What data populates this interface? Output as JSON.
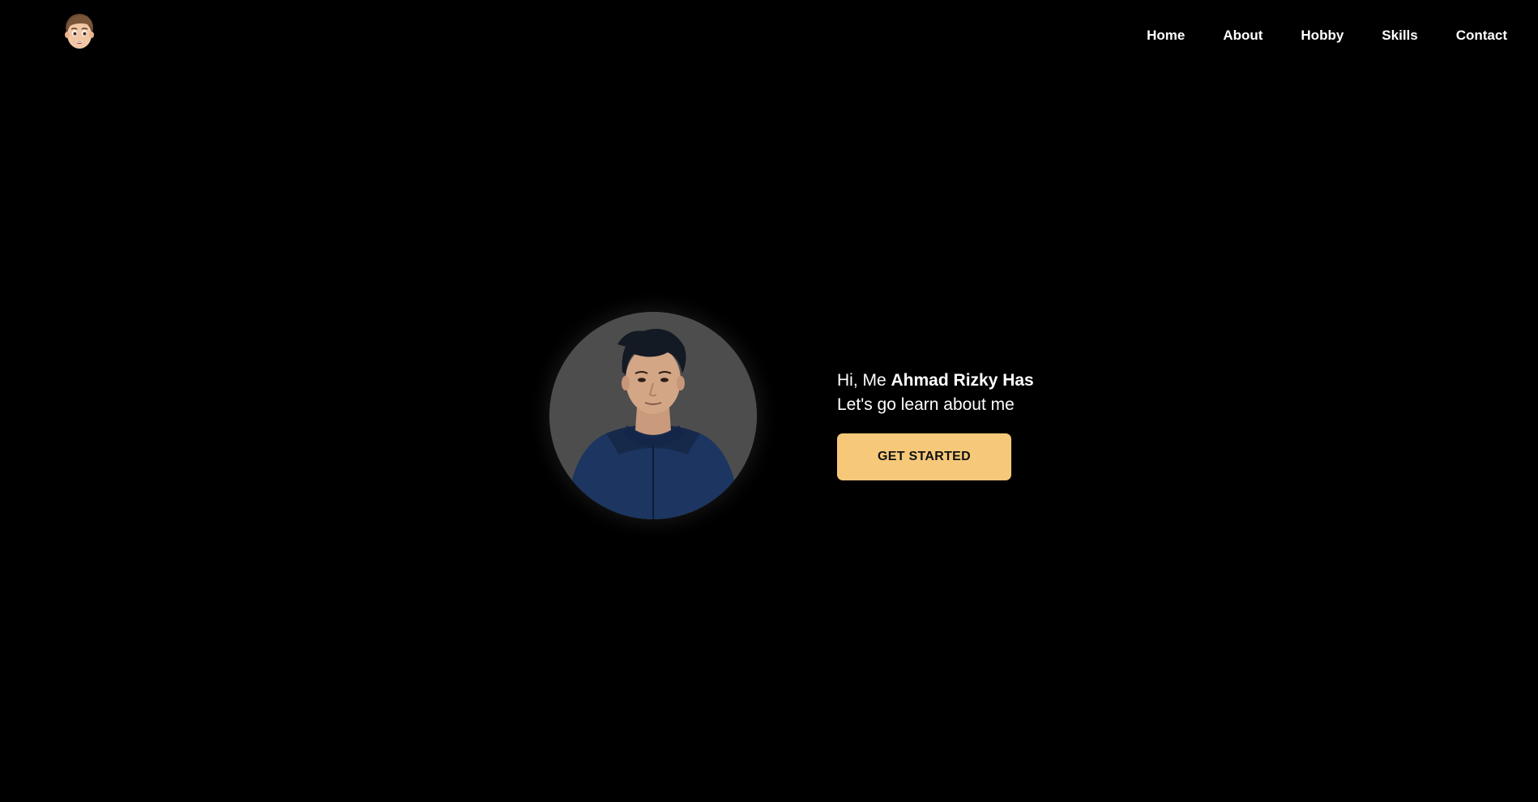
{
  "header": {
    "logo_icon": "memoji-avatar-icon",
    "nav": [
      {
        "label": "Home"
      },
      {
        "label": "About"
      },
      {
        "label": "Hobby"
      },
      {
        "label": "Skills"
      },
      {
        "label": "Contact"
      }
    ]
  },
  "hero": {
    "greeting_prefix": "Hi, Me ",
    "name": "Ahmad Rizky Has",
    "tagline": "Let's go learn about me",
    "cta_label": "GET STARTED",
    "photo_icon": "profile-photo",
    "colors": {
      "background": "#000000",
      "cta_background": "#f6c97a",
      "photo_background": "#4d4d4d"
    }
  }
}
